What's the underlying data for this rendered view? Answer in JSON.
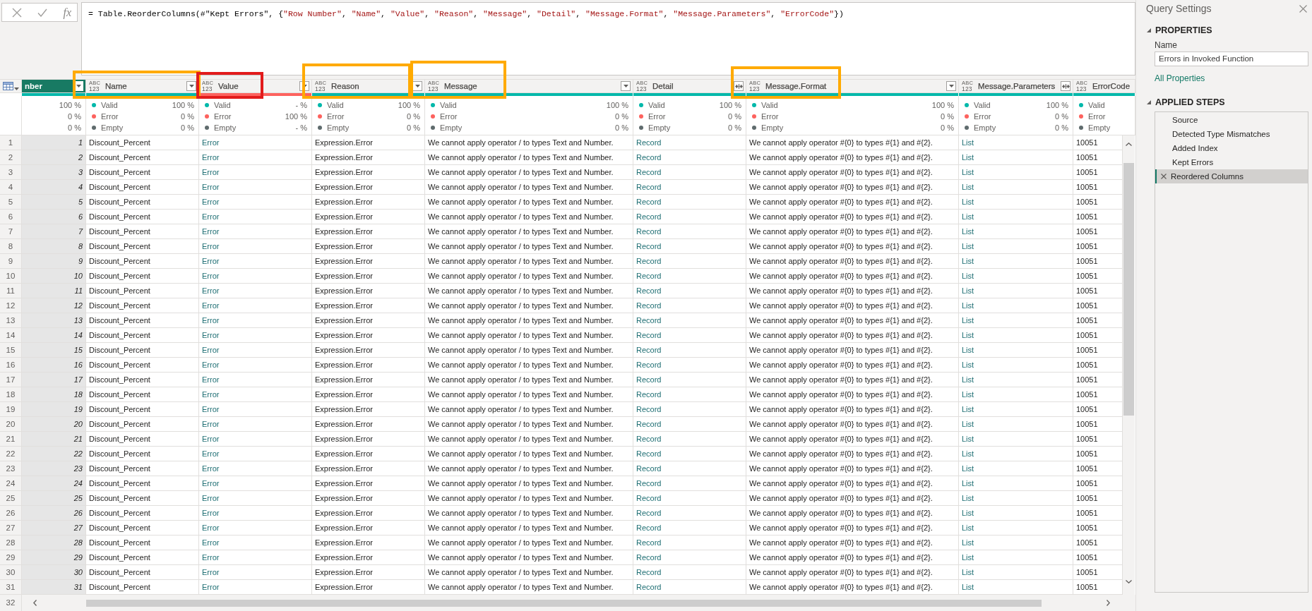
{
  "formula_bar": {
    "fx_label": "fx",
    "formula": [
      {
        "kind": "plain",
        "text": "= Table.ReorderColumns(#\"Kept Errors\", {"
      },
      {
        "kind": "string",
        "text": "\"Row Number\""
      },
      {
        "kind": "plain",
        "text": ", "
      },
      {
        "kind": "string",
        "text": "\"Name\""
      },
      {
        "kind": "plain",
        "text": ", "
      },
      {
        "kind": "string",
        "text": "\"Value\""
      },
      {
        "kind": "plain",
        "text": ", "
      },
      {
        "kind": "string",
        "text": "\"Reason\""
      },
      {
        "kind": "plain",
        "text": ", "
      },
      {
        "kind": "string",
        "text": "\"Message\""
      },
      {
        "kind": "plain",
        "text": ", "
      },
      {
        "kind": "string",
        "text": "\"Detail\""
      },
      {
        "kind": "plain",
        "text": ", "
      },
      {
        "kind": "string",
        "text": "\"Message.Format\""
      },
      {
        "kind": "plain",
        "text": ", "
      },
      {
        "kind": "string",
        "text": "\"Message.Parameters\""
      },
      {
        "kind": "plain",
        "text": ", "
      },
      {
        "kind": "string",
        "text": "\"ErrorCode\""
      },
      {
        "kind": "plain",
        "text": "})"
      }
    ]
  },
  "columns": [
    {
      "header": "nber",
      "selected": true,
      "kind": "number",
      "header_button": {
        "kind": "filter"
      },
      "level": 1,
      "stats": [
        {
          "value": "100 %"
        },
        {
          "value": "0 %"
        },
        {
          "value": "0 %"
        }
      ]
    },
    {
      "header": "Name",
      "type_label": [
        "ABC",
        "123"
      ],
      "selected": false,
      "kind": "text",
      "header_button": {
        "kind": "filter"
      },
      "level": 1,
      "highlight": {
        "color": "#ffaa00"
      },
      "stats": [
        {
          "label": "Valid",
          "value": "100 %",
          "color": "#01b8aa"
        },
        {
          "label": "Error",
          "value": "0 %",
          "color": "#fd625e"
        },
        {
          "label": "Empty",
          "value": "0 %",
          "color": "#5f6b6d"
        }
      ]
    },
    {
      "header": "Value",
      "type_label": [
        "ABC",
        "123"
      ],
      "selected": false,
      "kind": "link",
      "header_button": {
        "kind": "filter"
      },
      "level": 0,
      "highlight": {
        "color": "#e21b1b"
      },
      "stats": [
        {
          "label": "Valid",
          "value": "- %",
          "color": "#01b8aa"
        },
        {
          "label": "Error",
          "value": "100 %",
          "color": "#fd625e"
        },
        {
          "label": "Empty",
          "value": "- %",
          "color": "#5f6b6d"
        }
      ]
    },
    {
      "header": "Reason",
      "type_label": [
        "ABC",
        "123"
      ],
      "selected": false,
      "kind": "text",
      "header_button": {
        "kind": "filter"
      },
      "level": 1,
      "highlight": {
        "color": "#ffaa00"
      },
      "stats": [
        {
          "label": "Valid",
          "value": "100 %",
          "color": "#01b8aa"
        },
        {
          "label": "Error",
          "value": "0 %",
          "color": "#fd625e"
        },
        {
          "label": "Empty",
          "value": "0 %",
          "color": "#5f6b6d"
        }
      ]
    },
    {
      "header": "Message",
      "type_label": [
        "ABC",
        "123"
      ],
      "selected": false,
      "kind": "text",
      "header_button": {
        "kind": "filter"
      },
      "level": 1,
      "highlight": {
        "color": "#ffaa00"
      },
      "stats": [
        {
          "label": "Valid",
          "value": "100 %",
          "color": "#01b8aa"
        },
        {
          "label": "Error",
          "value": "0 %",
          "color": "#fd625e"
        },
        {
          "label": "Empty",
          "value": "0 %",
          "color": "#5f6b6d"
        }
      ]
    },
    {
      "header": "Detail",
      "type_label": [
        "ABC",
        "123"
      ],
      "selected": false,
      "kind": "link",
      "header_button": {
        "kind": "expand"
      },
      "level": 1,
      "stats": [
        {
          "label": "Valid",
          "value": "100 %",
          "color": "#01b8aa"
        },
        {
          "label": "Error",
          "value": "0 %",
          "color": "#fd625e"
        },
        {
          "label": "Empty",
          "value": "0 %",
          "color": "#5f6b6d"
        }
      ]
    },
    {
      "header": "Message.Format",
      "type_label": [
        "ABC",
        "123"
      ],
      "selected": false,
      "kind": "text",
      "header_button": {
        "kind": "filter"
      },
      "level": 1,
      "highlight": {
        "color": "#ffaa00"
      },
      "stats": [
        {
          "label": "Valid",
          "value": "100 %",
          "color": "#01b8aa"
        },
        {
          "label": "Error",
          "value": "0 %",
          "color": "#fd625e"
        },
        {
          "label": "Empty",
          "value": "0 %",
          "color": "#5f6b6d"
        }
      ]
    },
    {
      "header": "Message.Parameters",
      "type_label": [
        "ABC",
        "123"
      ],
      "selected": false,
      "kind": "link",
      "header_button": {
        "kind": "expand"
      },
      "level": 1,
      "stats": [
        {
          "label": "Valid",
          "value": "100 %",
          "color": "#01b8aa"
        },
        {
          "label": "Error",
          "value": "0 %",
          "color": "#fd625e"
        },
        {
          "label": "Empty",
          "value": "0 %",
          "color": "#5f6b6d"
        }
      ]
    },
    {
      "header": "ErrorCode",
      "type_label": [
        "ABC",
        "123"
      ],
      "selected": false,
      "kind": "text",
      "level": 1,
      "stats": [
        {
          "label": "Valid",
          "color": "#01b8aa"
        },
        {
          "label": "Error",
          "color": "#fd625e"
        },
        {
          "label": "Empty",
          "color": "#5f6b6d"
        }
      ]
    }
  ],
  "rows": [
    {
      "index": "1",
      "cells": [
        "1",
        "Discount_Percent",
        "Error",
        "Expression.Error",
        "We cannot apply operator / to types Text and Number.",
        "Record",
        "We cannot apply operator #{0} to types #{1} and #{2}.",
        "List",
        "10051"
      ]
    },
    {
      "index": "2",
      "cells": [
        "2",
        "Discount_Percent",
        "Error",
        "Expression.Error",
        "We cannot apply operator / to types Text and Number.",
        "Record",
        "We cannot apply operator #{0} to types #{1} and #{2}.",
        "List",
        "10051"
      ]
    },
    {
      "index": "3",
      "cells": [
        "3",
        "Discount_Percent",
        "Error",
        "Expression.Error",
        "We cannot apply operator / to types Text and Number.",
        "Record",
        "We cannot apply operator #{0} to types #{1} and #{2}.",
        "List",
        "10051"
      ]
    },
    {
      "index": "4",
      "cells": [
        "4",
        "Discount_Percent",
        "Error",
        "Expression.Error",
        "We cannot apply operator / to types Text and Number.",
        "Record",
        "We cannot apply operator #{0} to types #{1} and #{2}.",
        "List",
        "10051"
      ]
    },
    {
      "index": "5",
      "cells": [
        "5",
        "Discount_Percent",
        "Error",
        "Expression.Error",
        "We cannot apply operator / to types Text and Number.",
        "Record",
        "We cannot apply operator #{0} to types #{1} and #{2}.",
        "List",
        "10051"
      ]
    },
    {
      "index": "6",
      "cells": [
        "6",
        "Discount_Percent",
        "Error",
        "Expression.Error",
        "We cannot apply operator / to types Text and Number.",
        "Record",
        "We cannot apply operator #{0} to types #{1} and #{2}.",
        "List",
        "10051"
      ]
    },
    {
      "index": "7",
      "cells": [
        "7",
        "Discount_Percent",
        "Error",
        "Expression.Error",
        "We cannot apply operator / to types Text and Number.",
        "Record",
        "We cannot apply operator #{0} to types #{1} and #{2}.",
        "List",
        "10051"
      ]
    },
    {
      "index": "8",
      "cells": [
        "8",
        "Discount_Percent",
        "Error",
        "Expression.Error",
        "We cannot apply operator / to types Text and Number.",
        "Record",
        "We cannot apply operator #{0} to types #{1} and #{2}.",
        "List",
        "10051"
      ]
    },
    {
      "index": "9",
      "cells": [
        "9",
        "Discount_Percent",
        "Error",
        "Expression.Error",
        "We cannot apply operator / to types Text and Number.",
        "Record",
        "We cannot apply operator #{0} to types #{1} and #{2}.",
        "List",
        "10051"
      ]
    },
    {
      "index": "10",
      "cells": [
        "10",
        "Discount_Percent",
        "Error",
        "Expression.Error",
        "We cannot apply operator / to types Text and Number.",
        "Record",
        "We cannot apply operator #{0} to types #{1} and #{2}.",
        "List",
        "10051"
      ]
    },
    {
      "index": "11",
      "cells": [
        "11",
        "Discount_Percent",
        "Error",
        "Expression.Error",
        "We cannot apply operator / to types Text and Number.",
        "Record",
        "We cannot apply operator #{0} to types #{1} and #{2}.",
        "List",
        "10051"
      ]
    },
    {
      "index": "12",
      "cells": [
        "12",
        "Discount_Percent",
        "Error",
        "Expression.Error",
        "We cannot apply operator / to types Text and Number.",
        "Record",
        "We cannot apply operator #{0} to types #{1} and #{2}.",
        "List",
        "10051"
      ]
    },
    {
      "index": "13",
      "cells": [
        "13",
        "Discount_Percent",
        "Error",
        "Expression.Error",
        "We cannot apply operator / to types Text and Number.",
        "Record",
        "We cannot apply operator #{0} to types #{1} and #{2}.",
        "List",
        "10051"
      ]
    },
    {
      "index": "14",
      "cells": [
        "14",
        "Discount_Percent",
        "Error",
        "Expression.Error",
        "We cannot apply operator / to types Text and Number.",
        "Record",
        "We cannot apply operator #{0} to types #{1} and #{2}.",
        "List",
        "10051"
      ]
    },
    {
      "index": "15",
      "cells": [
        "15",
        "Discount_Percent",
        "Error",
        "Expression.Error",
        "We cannot apply operator / to types Text and Number.",
        "Record",
        "We cannot apply operator #{0} to types #{1} and #{2}.",
        "List",
        "10051"
      ]
    },
    {
      "index": "16",
      "cells": [
        "16",
        "Discount_Percent",
        "Error",
        "Expression.Error",
        "We cannot apply operator / to types Text and Number.",
        "Record",
        "We cannot apply operator #{0} to types #{1} and #{2}.",
        "List",
        "10051"
      ]
    },
    {
      "index": "17",
      "cells": [
        "17",
        "Discount_Percent",
        "Error",
        "Expression.Error",
        "We cannot apply operator / to types Text and Number.",
        "Record",
        "We cannot apply operator #{0} to types #{1} and #{2}.",
        "List",
        "10051"
      ]
    },
    {
      "index": "18",
      "cells": [
        "18",
        "Discount_Percent",
        "Error",
        "Expression.Error",
        "We cannot apply operator / to types Text and Number.",
        "Record",
        "We cannot apply operator #{0} to types #{1} and #{2}.",
        "List",
        "10051"
      ]
    },
    {
      "index": "19",
      "cells": [
        "19",
        "Discount_Percent",
        "Error",
        "Expression.Error",
        "We cannot apply operator / to types Text and Number.",
        "Record",
        "We cannot apply operator #{0} to types #{1} and #{2}.",
        "List",
        "10051"
      ]
    },
    {
      "index": "20",
      "cells": [
        "20",
        "Discount_Percent",
        "Error",
        "Expression.Error",
        "We cannot apply operator / to types Text and Number.",
        "Record",
        "We cannot apply operator #{0} to types #{1} and #{2}.",
        "List",
        "10051"
      ]
    },
    {
      "index": "21",
      "cells": [
        "21",
        "Discount_Percent",
        "Error",
        "Expression.Error",
        "We cannot apply operator / to types Text and Number.",
        "Record",
        "We cannot apply operator #{0} to types #{1} and #{2}.",
        "List",
        "10051"
      ]
    },
    {
      "index": "22",
      "cells": [
        "22",
        "Discount_Percent",
        "Error",
        "Expression.Error",
        "We cannot apply operator / to types Text and Number.",
        "Record",
        "We cannot apply operator #{0} to types #{1} and #{2}.",
        "List",
        "10051"
      ]
    },
    {
      "index": "23",
      "cells": [
        "23",
        "Discount_Percent",
        "Error",
        "Expression.Error",
        "We cannot apply operator / to types Text and Number.",
        "Record",
        "We cannot apply operator #{0} to types #{1} and #{2}.",
        "List",
        "10051"
      ]
    },
    {
      "index": "24",
      "cells": [
        "24",
        "Discount_Percent",
        "Error",
        "Expression.Error",
        "We cannot apply operator / to types Text and Number.",
        "Record",
        "We cannot apply operator #{0} to types #{1} and #{2}.",
        "List",
        "10051"
      ]
    },
    {
      "index": "25",
      "cells": [
        "25",
        "Discount_Percent",
        "Error",
        "Expression.Error",
        "We cannot apply operator / to types Text and Number.",
        "Record",
        "We cannot apply operator #{0} to types #{1} and #{2}.",
        "List",
        "10051"
      ]
    },
    {
      "index": "26",
      "cells": [
        "26",
        "Discount_Percent",
        "Error",
        "Expression.Error",
        "We cannot apply operator / to types Text and Number.",
        "Record",
        "We cannot apply operator #{0} to types #{1} and #{2}.",
        "List",
        "10051"
      ]
    },
    {
      "index": "27",
      "cells": [
        "27",
        "Discount_Percent",
        "Error",
        "Expression.Error",
        "We cannot apply operator / to types Text and Number.",
        "Record",
        "We cannot apply operator #{0} to types #{1} and #{2}.",
        "List",
        "10051"
      ]
    },
    {
      "index": "28",
      "cells": [
        "28",
        "Discount_Percent",
        "Error",
        "Expression.Error",
        "We cannot apply operator / to types Text and Number.",
        "Record",
        "We cannot apply operator #{0} to types #{1} and #{2}.",
        "List",
        "10051"
      ]
    },
    {
      "index": "29",
      "cells": [
        "29",
        "Discount_Percent",
        "Error",
        "Expression.Error",
        "We cannot apply operator / to types Text and Number.",
        "Record",
        "We cannot apply operator #{0} to types #{1} and #{2}.",
        "List",
        "10051"
      ]
    },
    {
      "index": "30",
      "cells": [
        "30",
        "Discount_Percent",
        "Error",
        "Expression.Error",
        "We cannot apply operator / to types Text and Number.",
        "Record",
        "We cannot apply operator #{0} to types #{1} and #{2}.",
        "List",
        "10051"
      ]
    },
    {
      "index": "31",
      "cells": [
        "31",
        "Discount_Percent",
        "Error",
        "Expression.Error",
        "We cannot apply operator / to types Text and Number.",
        "Record",
        "We cannot apply operator #{0} to types #{1} and #{2}.",
        "List",
        "10051"
      ]
    },
    {
      "index": "32"
    }
  ],
  "query_settings": {
    "title": "Query Settings",
    "properties": {
      "heading": "PROPERTIES",
      "expanded": true,
      "name_label": "Name",
      "name_value": "Errors in Invoked Function",
      "link": "All Properties"
    },
    "applied_steps": {
      "heading": "APPLIED STEPS",
      "expanded": true,
      "steps": [
        {
          "label": "Source",
          "selected": false
        },
        {
          "label": "Detected Type Mismatches",
          "selected": false
        },
        {
          "label": "Added Index",
          "selected": false
        },
        {
          "label": "Kept Errors",
          "selected": false
        },
        {
          "label": "Reordered Columns",
          "selected": true
        }
      ]
    }
  }
}
